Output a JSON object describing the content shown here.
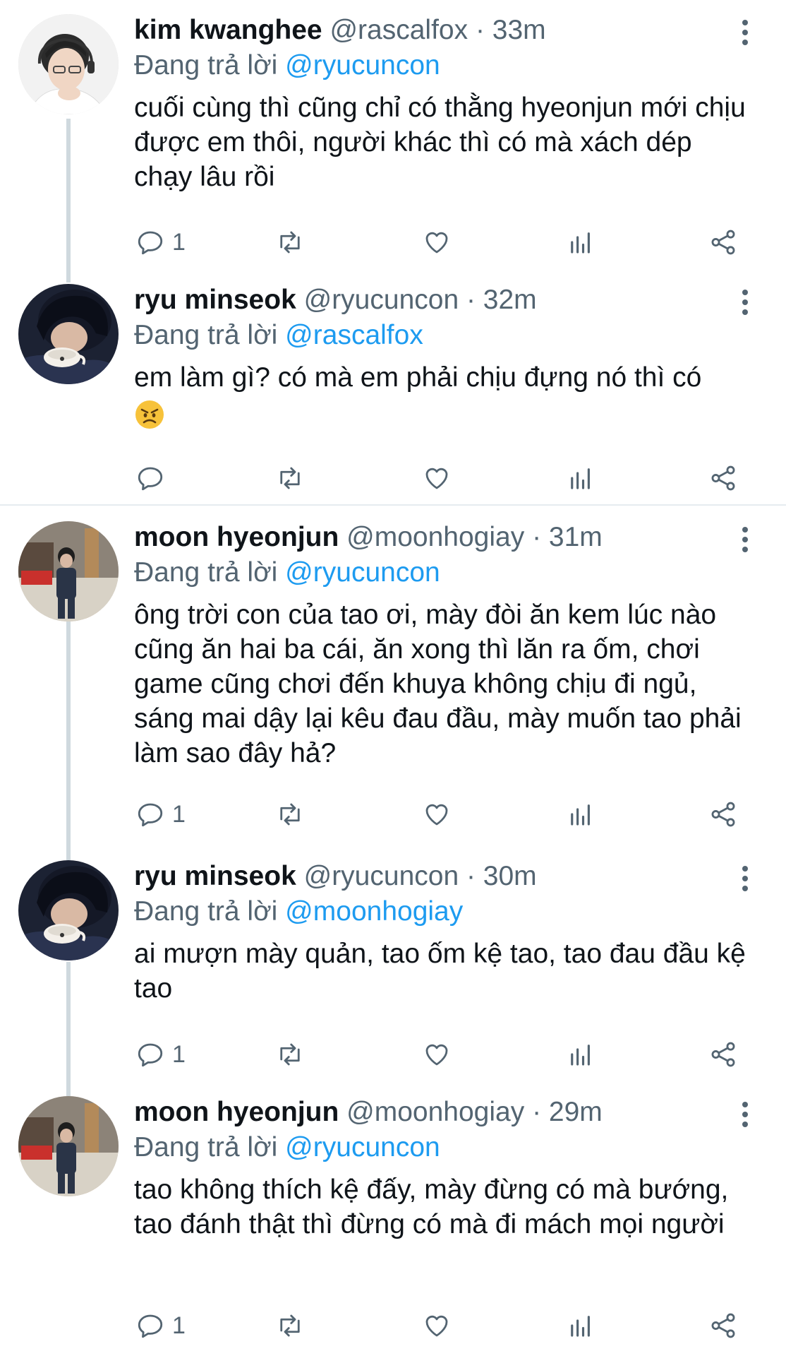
{
  "tweets": [
    {
      "name": "kim kwanghee",
      "handle": "@rascalfox",
      "time": "· 33m",
      "reply_prefix": "Đang trả lời",
      "reply_to": "@ryucuncon",
      "text": "cuối cùng thì cũng chỉ có thằng hyeonjun mới chịu được em thôi, người khác thì có mà xách dép chạy lâu rồi",
      "reply_count": "1"
    },
    {
      "name": "ryu minseok",
      "handle": "@ryucuncon",
      "time": "· 32m",
      "reply_prefix": "Đang trả lời",
      "reply_to": "@rascalfox",
      "text": "em làm gì? có mà em phải chịu đựng nó thì có",
      "emoji": "angry-face-emoji",
      "reply_count": ""
    },
    {
      "name": "moon hyeonjun",
      "handle": "@moonhogiay",
      "time": "· 31m",
      "reply_prefix": "Đang trả lời",
      "reply_to": "@ryucuncon",
      "text": "ông trời con của tao ơi, mày đòi ăn kem lúc nào cũng ăn hai ba cái, ăn xong thì lăn ra ốm, chơi game cũng chơi đến khuya không chịu đi ngủ, sáng mai dậy lại kêu đau đầu, mày muốn tao phải làm sao đây hả?",
      "reply_count": "1"
    },
    {
      "name": "ryu minseok",
      "handle": "@ryucuncon",
      "time": "· 30m",
      "reply_prefix": "Đang trả lời",
      "reply_to": "@moonhogiay",
      "text": "ai mượn mày quản, tao ốm kệ tao, tao đau đầu kệ tao",
      "reply_count": "1"
    },
    {
      "name": "moon hyeonjun",
      "handle": "@moonhogiay",
      "time": "· 29m",
      "reply_prefix": "Đang trả lời",
      "reply_to": "@ryucuncon",
      "text": "tao không thích kệ đấy, mày đừng có mà bướng, tao đánh thật thì đừng có mà đi mách mọi người",
      "reply_count": "1"
    }
  ],
  "icons": {
    "reply": "reply-icon",
    "retweet": "retweet-icon",
    "like": "like-icon",
    "views": "views-icon",
    "share": "share-icon",
    "more": "more-options-icon"
  },
  "colors": {
    "name": "#0f1419",
    "secondary": "#536471",
    "mention": "#1d9bf0",
    "thread_line": "#cfd9de",
    "divider": "#e6ecf0"
  }
}
